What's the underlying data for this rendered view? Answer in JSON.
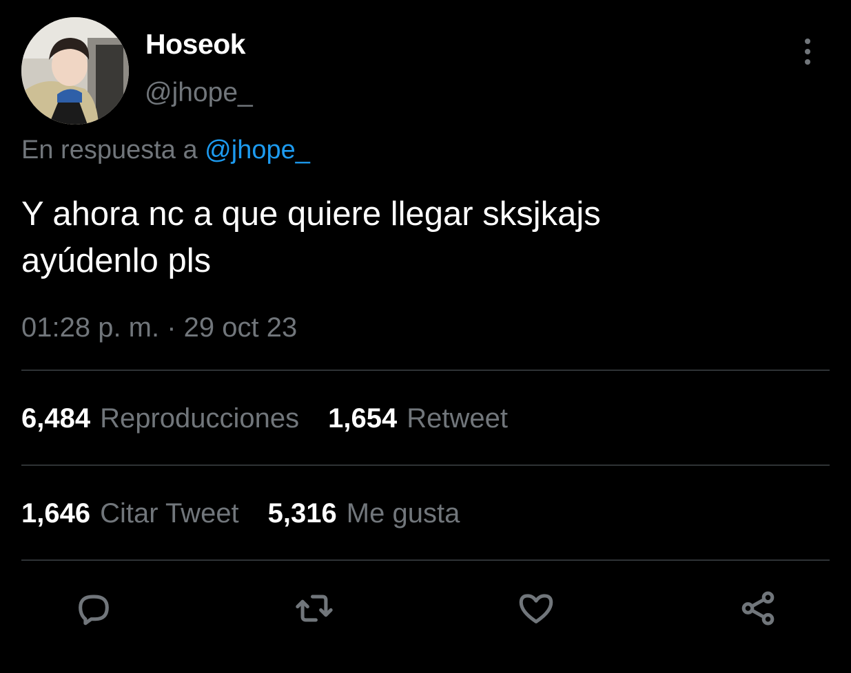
{
  "author": {
    "display_name": "Hoseok",
    "handle": "@jhope_"
  },
  "reply": {
    "prefix": "En respuesta a ",
    "mention": "@jhope_"
  },
  "tweet": {
    "text_line1": "Y ahora nc a que quiere llegar sksjkajs",
    "text_line2": "ayúdenlo pls",
    "timestamp": "01:28 p. m. · 29 oct 23"
  },
  "stats": {
    "views_count": "6,484",
    "views_label": "Reproducciones",
    "retweets_count": "1,654",
    "retweets_label": "Retweet",
    "quotes_count": "1,646",
    "quotes_label": "Citar Tweet",
    "likes_count": "5,316",
    "likes_label": "Me gusta"
  },
  "icons": {
    "more": "more-vertical-icon",
    "reply": "reply-icon",
    "retweet": "retweet-icon",
    "like": "heart-icon",
    "share": "share-icon"
  },
  "colors": {
    "background": "#000000",
    "primary_text": "#ffffff",
    "secondary_text": "#71767b",
    "accent": "#1d9bf0",
    "divider": "#2f3336"
  }
}
